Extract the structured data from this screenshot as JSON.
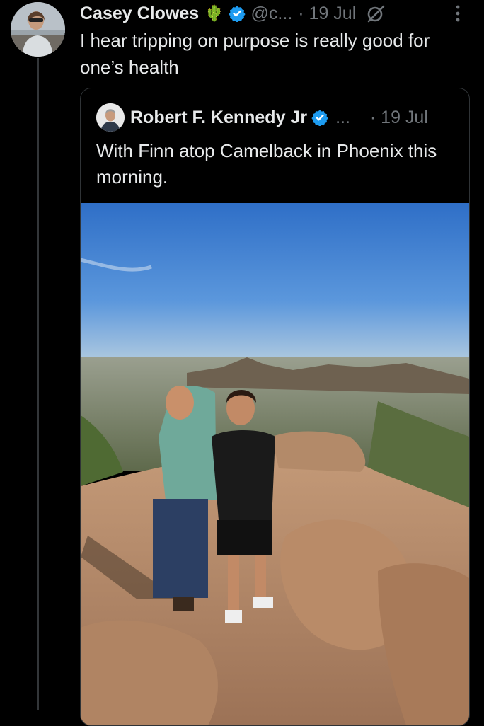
{
  "post": {
    "author_name": "Casey Clowes",
    "author_emoji": "🌵",
    "handle": "@c...",
    "date": "· 19 Jul",
    "text": "I hear tripping on purpose is really good for one’s health"
  },
  "quoted_post": {
    "author_name": "Robert F. Kennedy Jr",
    "handle": "...",
    "date": "· 19 Jul",
    "text": "With Finn atop Camelback in Phoenix this morning."
  },
  "icons": {
    "verified": "verified-badge-icon",
    "grok": "grok-icon",
    "more": "more-vertical-icon"
  },
  "colors": {
    "background": "#000000",
    "text": "#e7e9ea",
    "secondary": "#71767b",
    "verified": "#1d9bf0",
    "cactus": "#4caf50",
    "border": "#2f3336"
  }
}
